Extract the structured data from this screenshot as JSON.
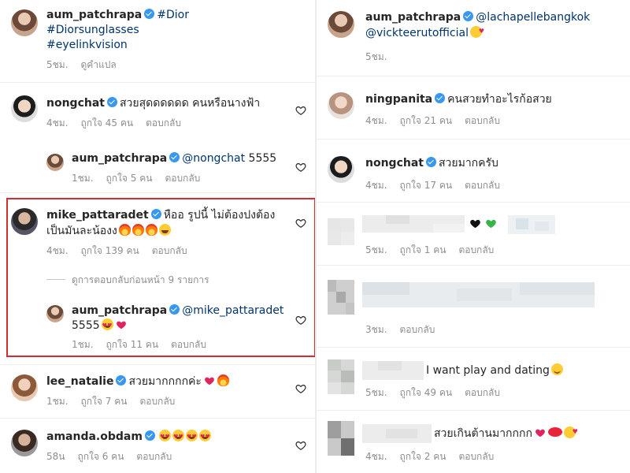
{
  "left": {
    "caption": {
      "username": "aum_patchrapa",
      "tags": [
        "#Dior",
        "#Diorsunglasses",
        "#eyelinkvision"
      ],
      "time": "5ชม.",
      "translate": "ดูคำแปล"
    },
    "comments": [
      {
        "username": "nongchat",
        "text": "สวยสุดดดดดด คนหรือนางฟ้า",
        "time": "4ชม.",
        "likes": "ถูกใจ 45 คน",
        "reply": "ตอบกลับ"
      },
      {
        "username": "aum_patchrapa",
        "mention": "@nongchat",
        "text": "5555",
        "time": "1ชม.",
        "likes": "ถูกใจ 5 คน",
        "reply": "ตอบกลับ"
      },
      {
        "username": "mike_pattaradet",
        "text": "หืออ รูปนี้ ไม่ต้องปงต้อง",
        "text2": "เป็นมันละน้องง",
        "time": "4ชม.",
        "likes": "ถูกใจ 139 คน",
        "reply": "ตอบกลับ"
      },
      {
        "username": "aum_patchrapa",
        "mention": "@mike_pattaradet",
        "text2": "5555",
        "time": "1ชม.",
        "likes": "ถูกใจ 11 คน",
        "reply": "ตอบกลับ"
      },
      {
        "username": "lee_natalie",
        "text": "สวยมากกกกค่ะ",
        "time": "1ชม.",
        "likes": "ถูกใจ 7 คน",
        "reply": "ตอบกลับ"
      },
      {
        "username": "amanda.obdam",
        "time": "58น",
        "likes": "ถูกใจ 6 คน",
        "reply": "ตอบกลับ"
      }
    ],
    "view_replies": "ดูการตอบกลับก่อนหน้า 9 รายการ"
  },
  "right": {
    "caption": {
      "username": "aum_patchrapa",
      "mention1": "@lachapellebangkok",
      "mention2": "@vickteerutofficial",
      "time": "5ชม."
    },
    "comments": [
      {
        "username": "ningpanita",
        "text": "คนสวยทำอะไรก้อสวย",
        "time": "4ชม.",
        "likes": "ถูกใจ 21 คน",
        "reply": "ตอบกลับ"
      },
      {
        "username": "nongchat",
        "text": "สวยมากครับ",
        "time": "4ชม.",
        "likes": "ถูกใจ 17 คน",
        "reply": "ตอบกลับ"
      },
      {
        "time": "5ชม.",
        "likes": "ถูกใจ 1 คน",
        "reply": "ตอบกลับ"
      },
      {
        "time": "3ชม.",
        "reply": "ตอบกลับ"
      },
      {
        "text": "I want play and dating",
        "time": "5ชม.",
        "likes": "ถูกใจ 49 คน",
        "reply": "ตอบกลับ"
      },
      {
        "text": "สวยเกินต้านมากกกก",
        "time": "4ชม.",
        "likes": "ถูกใจ 2 คน",
        "reply": "ตอบกลับ"
      }
    ]
  },
  "colors": {
    "text": "#262626",
    "meta": "#8e8e8e",
    "link": "#003569",
    "verified": "#3897f0",
    "highlight": "#d32f2f"
  }
}
